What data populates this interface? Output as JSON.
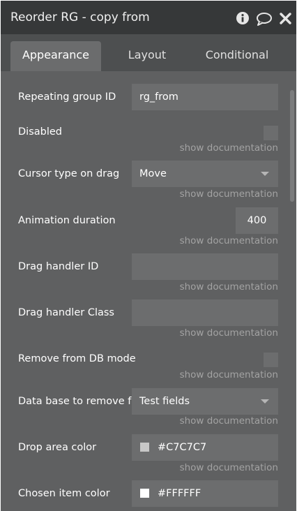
{
  "window": {
    "title": "Reorder RG - copy from"
  },
  "tabs": [
    {
      "label": "Appearance"
    },
    {
      "label": "Layout"
    },
    {
      "label": "Conditional"
    }
  ],
  "doc_link": "show documentation",
  "properties": {
    "repeating_group_id": {
      "label": "Repeating group ID",
      "value": "rg_from"
    },
    "disabled": {
      "label": "Disabled"
    },
    "cursor_type": {
      "label": "Cursor type on drag",
      "value": "Move"
    },
    "animation_duration": {
      "label": "Animation duration",
      "value": "400"
    },
    "drag_handler_id": {
      "label": "Drag handler ID",
      "value": ""
    },
    "drag_handler_class": {
      "label": "Drag handler Class",
      "value": ""
    },
    "remove_from_db": {
      "label": "Remove from DB mode"
    },
    "database_remove": {
      "label": "Data base to remove f",
      "value": "Test fields"
    },
    "drop_area_color": {
      "label": "Drop area color",
      "value": "#C7C7C7",
      "swatch": "#c7c7c7"
    },
    "chosen_item_color": {
      "label": "Chosen item color",
      "value": "#FFFFFF",
      "swatch": "#ffffff"
    }
  }
}
